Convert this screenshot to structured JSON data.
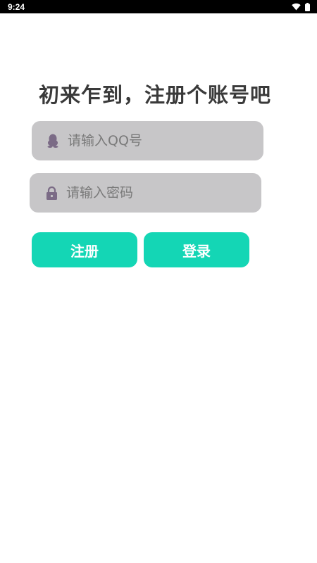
{
  "status_bar": {
    "time": "9:24",
    "icons": [
      "wifi-icon",
      "battery-icon"
    ]
  },
  "title": "初来乍到，注册个账号吧",
  "form": {
    "qq_input": {
      "placeholder": "请输入QQ号",
      "value": "",
      "icon": "qq-penguin-icon"
    },
    "password_input": {
      "placeholder": "请输入密码",
      "value": "",
      "icon": "lock-icon"
    }
  },
  "buttons": {
    "register_label": "注册",
    "login_label": "登录"
  },
  "colors": {
    "accent": "#14d6b5",
    "field_bg": "#c7c6c8",
    "icon": "#7b6b86",
    "title": "#3a3a3a"
  }
}
